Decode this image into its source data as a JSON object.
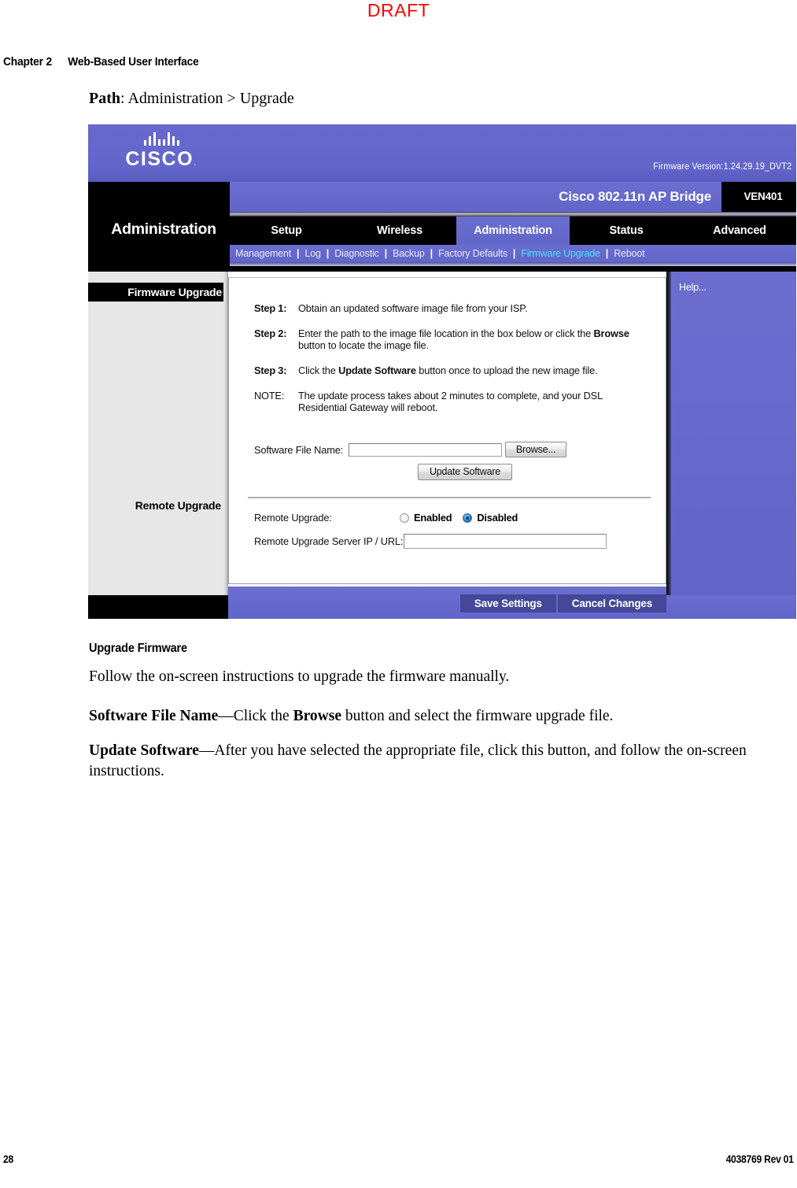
{
  "page": {
    "draft_watermark": "DRAFT",
    "chapter_label": "Chapter 2",
    "chapter_title": "Web-Based User Interface",
    "page_number": "28",
    "document_number": "4038769 Rev 01",
    "path_label": "Path",
    "path_value": ": Administration > Upgrade"
  },
  "router": {
    "brand": "CISCO",
    "brand_mark": ".",
    "firmware_version": "Firmware Version:1.24.29.19_DVT2",
    "section_title": "Administration",
    "model_name": "Cisco 802.11n AP Bridge",
    "model_code": "VEN401",
    "tabs": [
      {
        "label": "Setup",
        "active": false
      },
      {
        "label": "Wireless",
        "active": false
      },
      {
        "label": "Administration",
        "active": true
      },
      {
        "label": "Status",
        "active": false
      },
      {
        "label": "Advanced",
        "active": false
      }
    ],
    "subnav": [
      {
        "label": "Management",
        "current": false
      },
      {
        "label": "Log",
        "current": false
      },
      {
        "label": "Diagnostic",
        "current": false
      },
      {
        "label": "Backup",
        "current": false
      },
      {
        "label": "Factory Defaults",
        "current": false
      },
      {
        "label": "Firmware Upgrade",
        "current": true
      },
      {
        "label": "Reboot",
        "current": false
      }
    ],
    "sidebar": {
      "heading": "Firmware Upgrade",
      "label": "Remote Upgrade"
    },
    "steps": [
      {
        "key": "Step 1:",
        "bold_key": true,
        "text": "Obtain an updated software image file from your ISP."
      },
      {
        "key": "Step 2:",
        "bold_key": true,
        "text_1": "Enter the path to the image file location in the box below or click the ",
        "emphasis": "Browse",
        "text_2": " button to locate the image file."
      },
      {
        "key": "Step 3:",
        "bold_key": true,
        "text_1": "Click the ",
        "emphasis": "Update Software",
        "text_2": " button once to upload the new image file."
      },
      {
        "key": "NOTE:",
        "bold_key": false,
        "text": "The update process takes about 2 minutes to complete, and your DSL Residential Gateway will reboot."
      }
    ],
    "form": {
      "software_file_label": "Software File Name:",
      "software_file_value": "",
      "browse_button": "Browse...",
      "update_button": "Update Software",
      "remote_upgrade_label": "Remote Upgrade:",
      "remote_enabled_label": "Enabled",
      "remote_disabled_label": "Disabled",
      "remote_selected": "Disabled",
      "remote_url_label": "Remote Upgrade Server IP / URL:",
      "remote_url_value": ""
    },
    "help_text": "Help...",
    "save_button": "Save Settings",
    "cancel_button": "Cancel Changes",
    "accent_purple": "#6366cb",
    "accent_cyan": "#49e2ff",
    "button_navy": "#454899"
  },
  "prose": {
    "heading": "Upgrade Firmware",
    "p1": "Follow the on-screen instructions to upgrade the firmware manually.",
    "p2_bold": "Software File Name",
    "p2_rest_1": "—Click the ",
    "p2_bold_2": "Browse",
    "p2_rest_2": " button and select the firmware upgrade file.",
    "p3_bold": "Update Software",
    "p3_rest": "—After you have selected the appropriate file, click this button, and follow the on-screen instructions."
  }
}
